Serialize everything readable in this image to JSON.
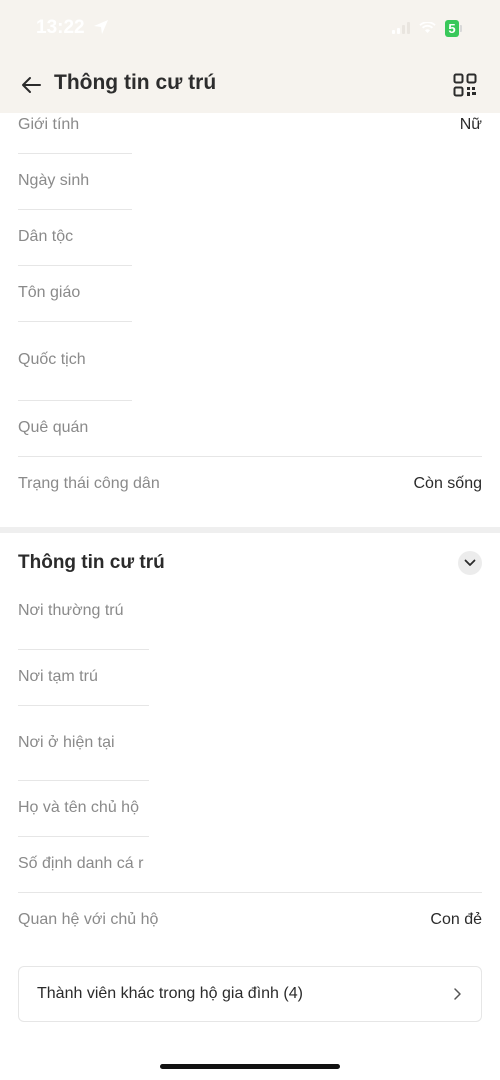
{
  "status_bar": {
    "time": "13:22",
    "battery_level": "5"
  },
  "header": {
    "title": "Thông tin cư trú"
  },
  "personal_info": {
    "rows": [
      {
        "label": "Giới tính",
        "value": "Nữ"
      },
      {
        "label": "Ngày sinh",
        "value": ""
      },
      {
        "label": "Dân tộc",
        "value": ""
      },
      {
        "label": "Tôn giáo",
        "value": ""
      },
      {
        "label": "Quốc tịch",
        "value": ""
      },
      {
        "label": "Quê quán",
        "value": ""
      },
      {
        "label": "Trạng thái công dân",
        "value": "Còn sống"
      }
    ]
  },
  "residence_section": {
    "title": "Thông tin cư trú",
    "rows": [
      {
        "label": "Nơi thường trú",
        "value": ""
      },
      {
        "label": "Nơi tạm trú",
        "value": ""
      },
      {
        "label": "Nơi ở hiện tại",
        "value": ""
      },
      {
        "label": "Họ và tên chủ hộ",
        "value": ""
      },
      {
        "label": "Số định danh cá r",
        "value": ""
      },
      {
        "label": "Quan hệ với chủ hộ",
        "value": "Con đẻ"
      }
    ],
    "family_button_label": "Thành viên khác trong hộ gia đình (4)"
  },
  "colors": {
    "header_bg": "#f6f3ee",
    "battery": "#39c85a",
    "label": "#8a8a8a"
  }
}
